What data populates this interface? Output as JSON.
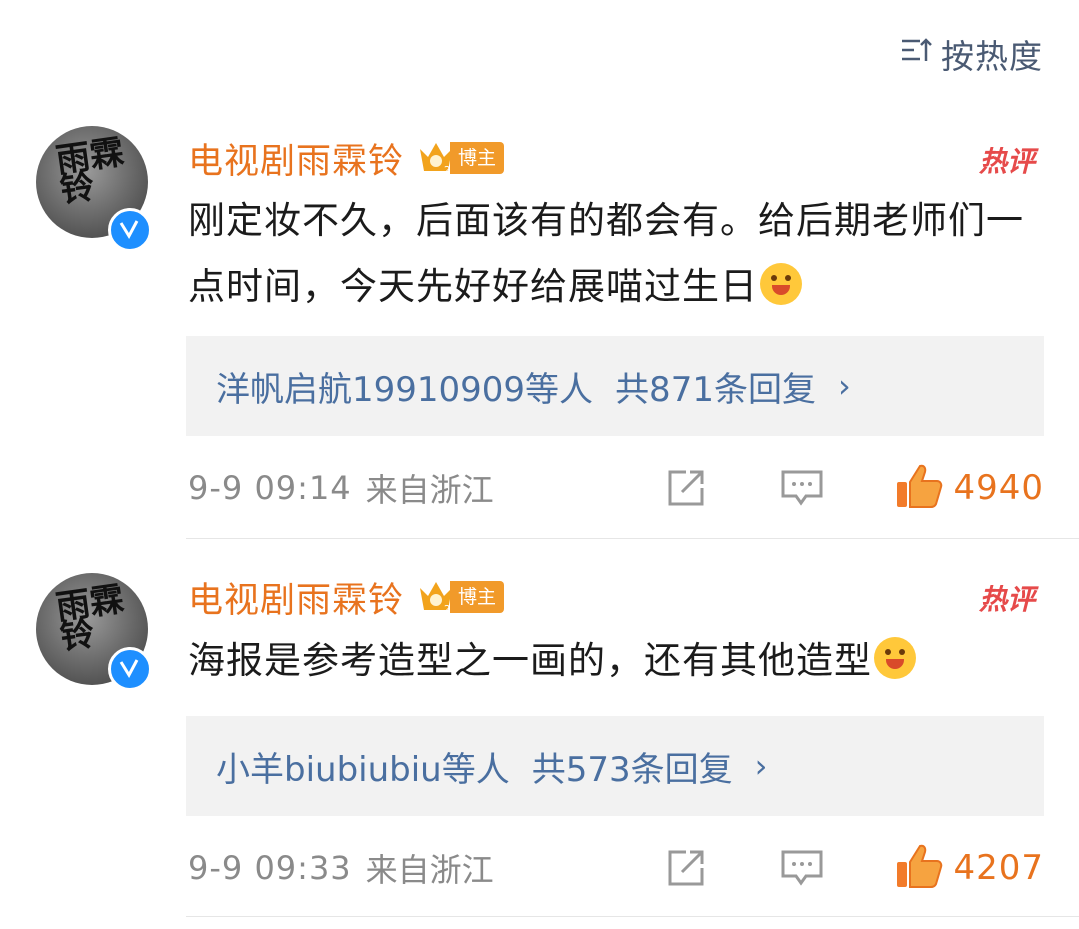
{
  "sort": {
    "label": "按热度",
    "icon": "sort-icon"
  },
  "colors": {
    "name": "#e8731e",
    "link": "#4a6fa0",
    "hot": "#e64a4a",
    "like": "#e8731e"
  },
  "comments": [
    {
      "avatar_text": "雨霖铃",
      "name": "电视剧雨霖铃",
      "badge": "博主",
      "hot_label": "热评",
      "text": "刚定妆不久，后面该有的都会有。给后期老师们一点时间，今天先好好给展喵过生日",
      "replies_who": "洋帆启航19910909等人",
      "replies_count": "共871条回复",
      "replies_chevron": "›",
      "time": "9-9 09:14",
      "location": "来自浙江",
      "likes": "4940"
    },
    {
      "avatar_text": "雨霖铃",
      "name": "电视剧雨霖铃",
      "badge": "博主",
      "hot_label": "热评",
      "text": "海报是参考造型之一画的，还有其他造型",
      "replies_who": "小羊biubiubiu等人",
      "replies_count": "共573条回复",
      "replies_chevron": "›",
      "time": "9-9 09:33",
      "location": "来自浙江",
      "likes": "4207"
    }
  ]
}
